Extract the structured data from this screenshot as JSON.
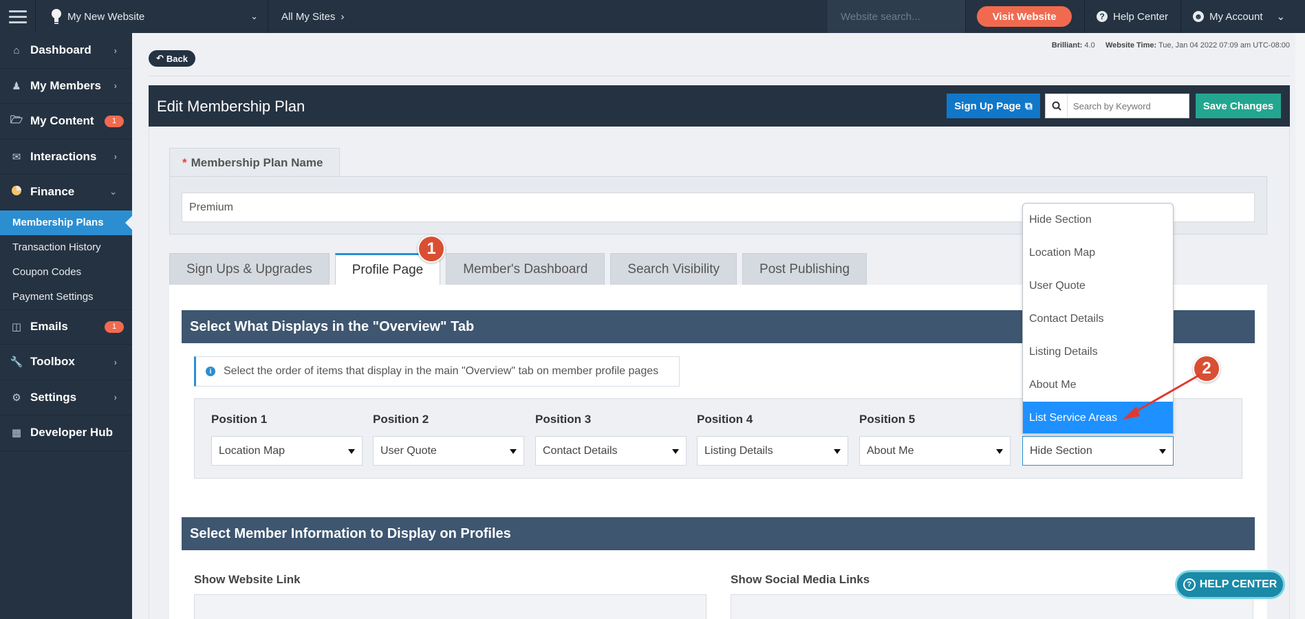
{
  "topbar": {
    "site_name": "My New Website",
    "all_sites": "All My Sites",
    "search_placeholder": "Website search...",
    "visit_label": "Visit Website",
    "help_label": "Help Center",
    "account_label": "My Account"
  },
  "sidebar": {
    "items": [
      {
        "label": "Dashboard"
      },
      {
        "label": "My Members"
      },
      {
        "label": "My Content",
        "badge": "1"
      },
      {
        "label": "Interactions"
      },
      {
        "label": "Finance"
      },
      {
        "label": "Emails",
        "badge": "1"
      },
      {
        "label": "Toolbox"
      },
      {
        "label": "Settings"
      },
      {
        "label": "Developer Hub"
      }
    ],
    "finance_sub": [
      "Membership Plans",
      "Transaction History",
      "Coupon Codes",
      "Payment Settings"
    ]
  },
  "page": {
    "back_label": "Back",
    "meta_version_label": "Brilliant:",
    "meta_version": "4.0",
    "meta_time_label": "Website Time:",
    "meta_time": "Tue, Jan 04 2022 07:09 am UTC-08:00",
    "title": "Edit Membership Plan",
    "signup_label": "Sign Up Page",
    "keyword_placeholder": "Search by Keyword",
    "save_label": "Save Changes"
  },
  "plan_name": {
    "required_mark": "*",
    "label": "Membership Plan Name",
    "value": "Premium"
  },
  "tabs": [
    "Sign Ups & Upgrades",
    "Profile Page",
    "Member's Dashboard",
    "Search Visibility",
    "Post Publishing"
  ],
  "overview": {
    "heading": "Select What Displays in the \"Overview\" Tab",
    "info": "Select the order of items that display in the main \"Overview\" tab on member profile pages",
    "positions": [
      {
        "label": "Position 1",
        "value": "Location Map"
      },
      {
        "label": "Position 2",
        "value": "User Quote"
      },
      {
        "label": "Position 3",
        "value": "Contact Details"
      },
      {
        "label": "Position 4",
        "value": "Listing Details"
      },
      {
        "label": "Position 5",
        "value": "About Me"
      },
      {
        "label": "",
        "value": "Hide Section"
      }
    ]
  },
  "dropdown": {
    "options": [
      "Hide Section",
      "Location Map",
      "User Quote",
      "Contact Details",
      "Listing Details",
      "About Me",
      "List Service Areas"
    ],
    "highlighted": "List Service Areas"
  },
  "annotations": {
    "step1": "1",
    "step2": "2",
    "arrow_color": "#e0392f"
  },
  "member_info": {
    "heading": "Select Member Information to Display on Profiles",
    "website_link_label": "Show Website Link",
    "social_links_label": "Show Social Media Links"
  },
  "help_float_label": "HELP CENTER",
  "colors": {
    "nav_bg": "#253241",
    "accent_blue": "#2b8ed1",
    "visit_orange": "#f16a4f",
    "save_green": "#23a68f",
    "section_head": "#3e5670"
  }
}
